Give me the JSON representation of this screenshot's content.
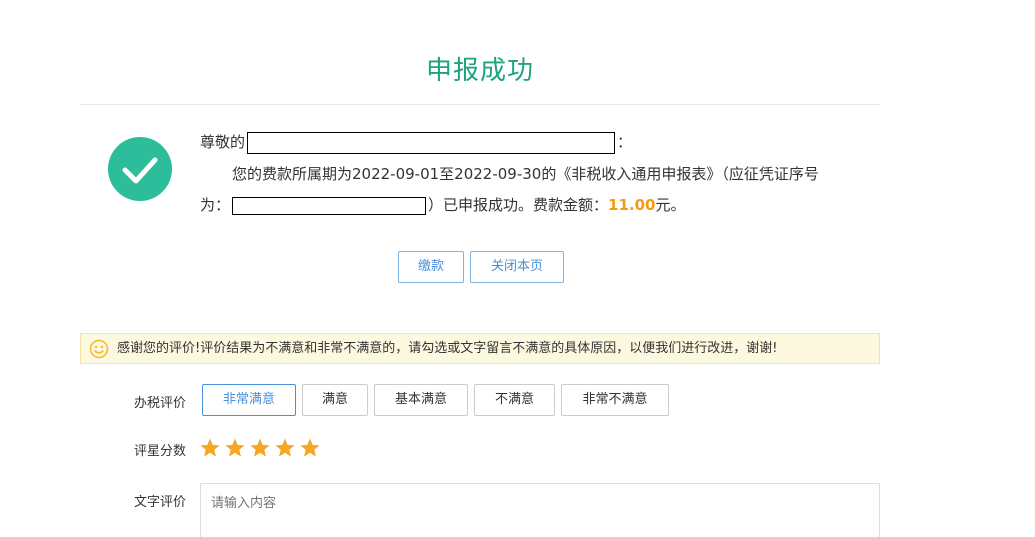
{
  "header": {
    "title": "申报成功"
  },
  "message": {
    "greeting_prefix": "尊敬的",
    "greeting_suffix": "：",
    "line2": "您的费款所属期为2022-09-01至2022-09-30的《非税收入通用申报表》（应征凭证序号",
    "line3_prefix": "为：",
    "line3_suffix": "）已申报成功。费款金额：",
    "amount": "11.00",
    "amount_unit": "元。"
  },
  "actions": {
    "pay_label": "缴款",
    "close_label": "关闭本页"
  },
  "notice": {
    "text": "感谢您的评价!评价结果为不满意和非常不满意的，请勾选或文字留言不满意的具体原因，以便我们进行改进，谢谢!"
  },
  "evaluation": {
    "rating_label": "办税评价",
    "options": [
      "非常满意",
      "满意",
      "基本满意",
      "不满意",
      "非常不满意"
    ],
    "selected": "非常满意",
    "score_label": "评星分数",
    "stars": 5,
    "stars_max": 5,
    "text_label": "文字评价",
    "text_placeholder": "请输入内容"
  },
  "colors": {
    "title": "#1fa27f",
    "success_icon": "#2dbd9a",
    "amount": "#f39c12",
    "star": "#f5a623",
    "primary": "#4a90d9"
  }
}
